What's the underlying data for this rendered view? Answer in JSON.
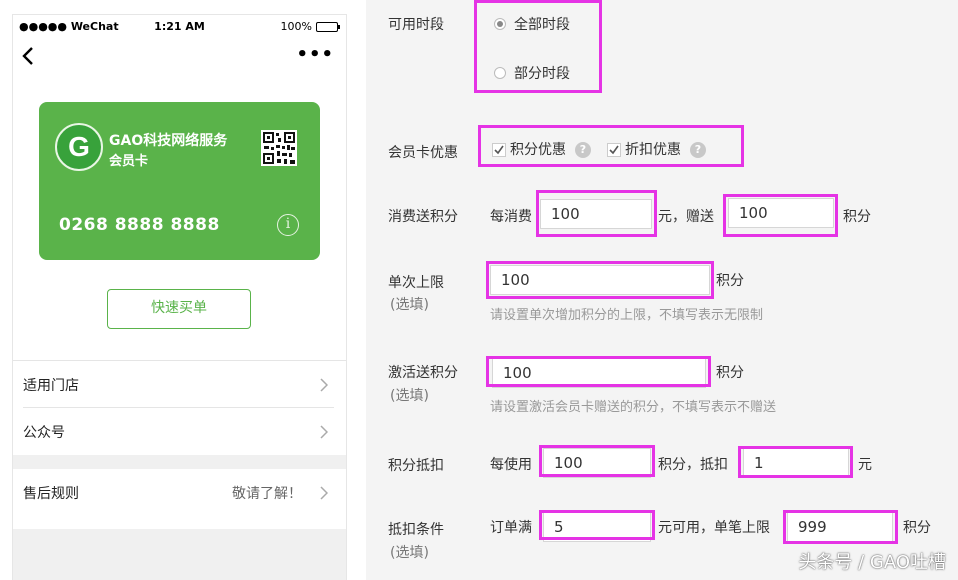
{
  "phone": {
    "status": {
      "signal": "●●●●● WeChat",
      "time": "1:21 AM",
      "battery": "100%"
    },
    "card": {
      "logo_letter": "G",
      "merchant_name": "GAO科技网络服务",
      "card_type": "会员卡",
      "card_number": "0268 8888 8888",
      "info_symbol": "i",
      "color": "#5ab34a"
    },
    "buy_button": "快速买单",
    "list": [
      {
        "label": "适用门店"
      },
      {
        "label": "公众号"
      }
    ],
    "after_sales": {
      "label": "售后规则",
      "value": "敬请了解！"
    }
  },
  "form": {
    "time_period": {
      "label": "可用时段",
      "options": [
        {
          "label": "全部时段",
          "checked": true
        },
        {
          "label": "部分时段",
          "checked": false
        }
      ]
    },
    "member_discount": {
      "label": "会员卡优惠",
      "options": [
        {
          "label": "积分优惠",
          "checked": true
        },
        {
          "label": "折扣优惠",
          "checked": true
        }
      ]
    },
    "spend_points": {
      "label": "消费送积分",
      "prefix": "每消费",
      "amount": "100",
      "mid": "元，赠送",
      "points": "100",
      "suffix": "积分"
    },
    "single_limit": {
      "label": "单次上限",
      "optional": "(选填)",
      "value": "100",
      "suffix": "积分",
      "hint": "请设置单次增加积分的上限，不填写表示无限制"
    },
    "activation_points": {
      "label": "激活送积分",
      "optional": "(选填)",
      "value": "100",
      "suffix": "积分",
      "hint": "请设置激活会员卡赠送的积分，不填写表示不赠送"
    },
    "points_deduct": {
      "label": "积分抵扣",
      "prefix": "每使用",
      "points": "100",
      "mid": "积分，抵扣",
      "yuan": "1",
      "suffix": "元"
    },
    "deduct_condition": {
      "label": "抵扣条件",
      "optional": "(选填)",
      "prefix": "订单满",
      "min_order": "5",
      "mid": "元可用，单笔上限",
      "max_points": "999",
      "suffix": "积分"
    },
    "highlight_color": "#e533e5"
  },
  "watermark": "头条号 / GAO吐槽"
}
